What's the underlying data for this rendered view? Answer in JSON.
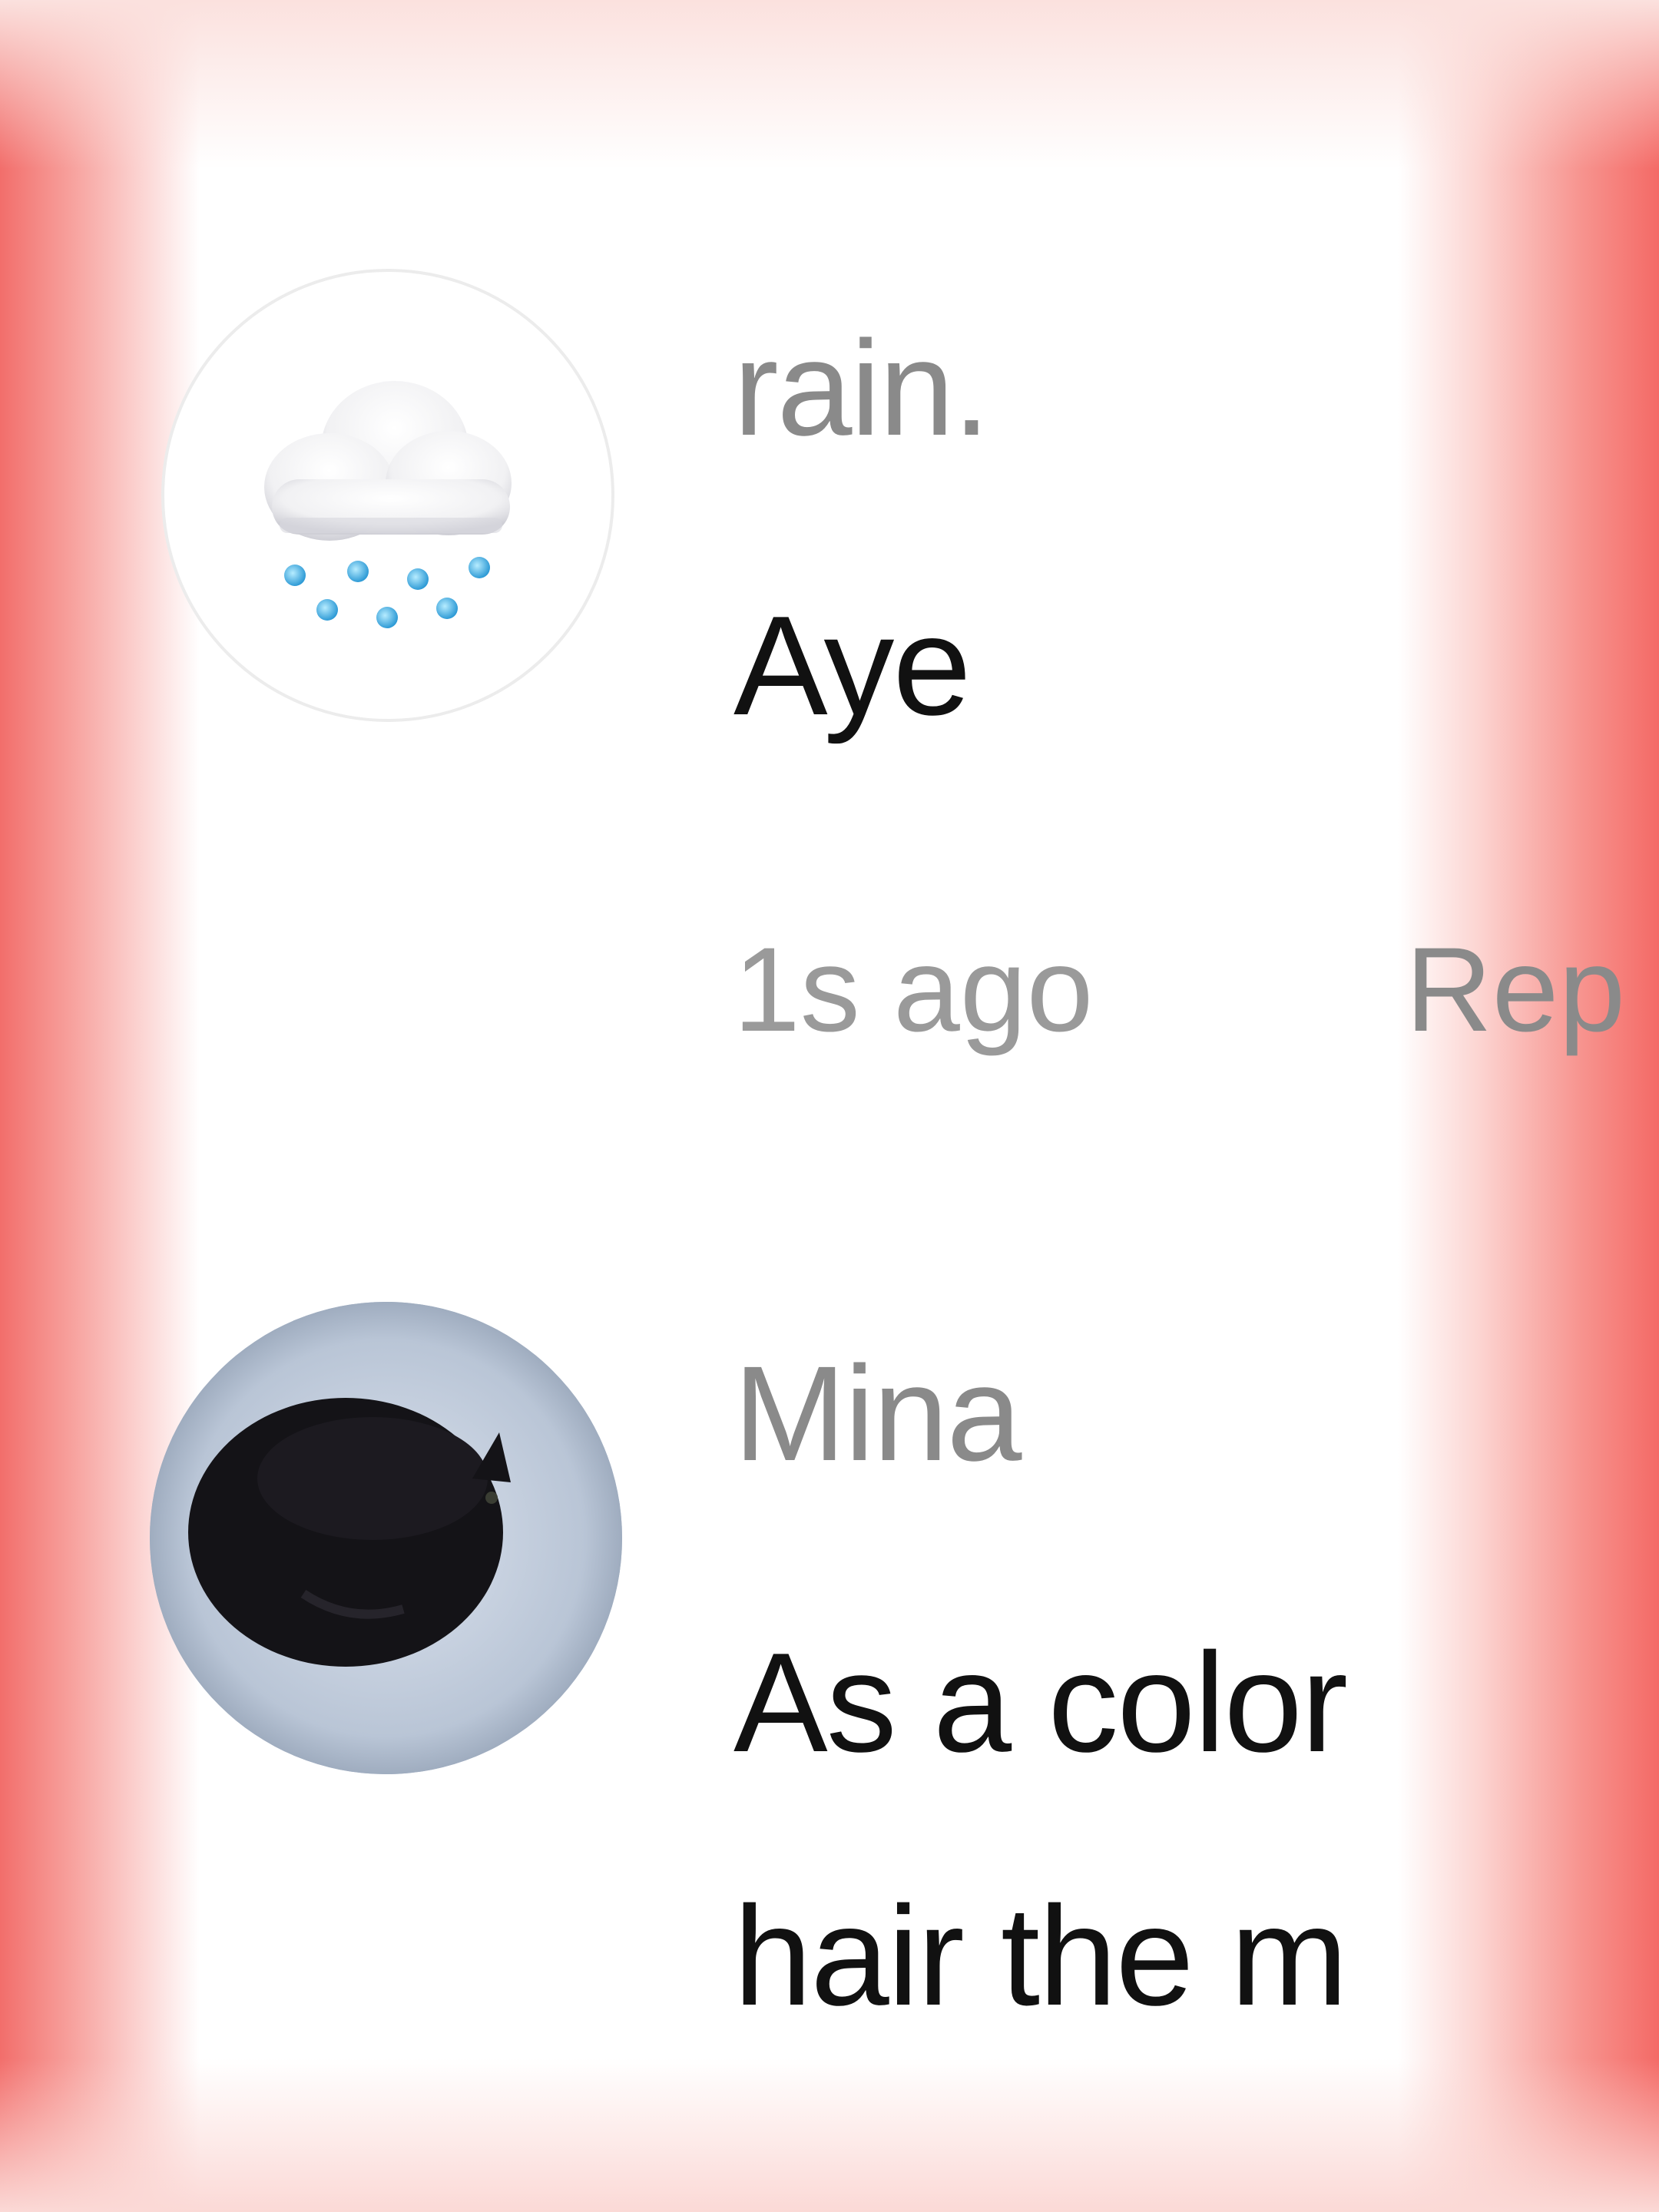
{
  "comments": [
    {
      "username": "rain.",
      "text": "Aye",
      "timestamp": "1s ago",
      "reply_label": "Rep",
      "avatar_icon": "cloud-with-rain-icon"
    },
    {
      "username": "Mina",
      "text_line1": "As a color",
      "text_line2": "hair the m",
      "avatar_icon": "black-cat-photo"
    }
  ],
  "colors": {
    "username": "#8a8a8a",
    "text": "#111111",
    "meta": "#9a9a9a",
    "edge": "#f26e6b"
  }
}
